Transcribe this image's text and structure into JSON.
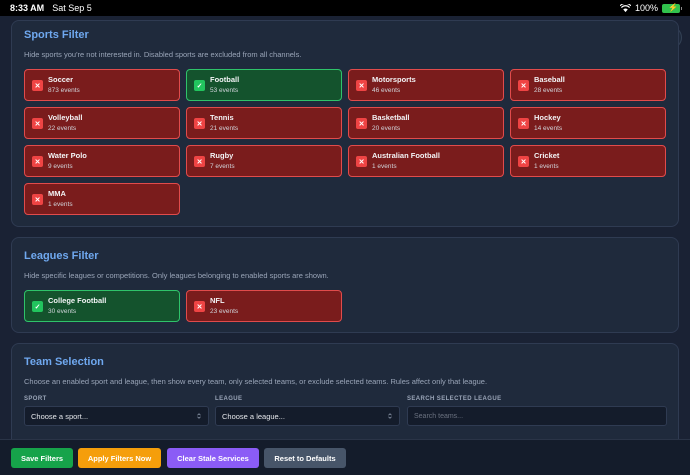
{
  "status_bar": {
    "time": "8:33 AM",
    "date": "Sat Sep 5",
    "battery": "100%"
  },
  "sports_filter": {
    "title": "Sports Filter",
    "description": "Hide sports you're not interested in. Disabled sports are excluded from all channels.",
    "items": [
      {
        "name": "Soccer",
        "count": "873 events",
        "enabled": false
      },
      {
        "name": "Football",
        "count": "53 events",
        "enabled": true
      },
      {
        "name": "Motorsports",
        "count": "46 events",
        "enabled": false
      },
      {
        "name": "Baseball",
        "count": "28 events",
        "enabled": false
      },
      {
        "name": "Volleyball",
        "count": "22 events",
        "enabled": false
      },
      {
        "name": "Tennis",
        "count": "21 events",
        "enabled": false
      },
      {
        "name": "Basketball",
        "count": "20 events",
        "enabled": false
      },
      {
        "name": "Hockey",
        "count": "14 events",
        "enabled": false
      },
      {
        "name": "Water Polo",
        "count": "9 events",
        "enabled": false
      },
      {
        "name": "Rugby",
        "count": "7 events",
        "enabled": false
      },
      {
        "name": "Australian Football",
        "count": "1 events",
        "enabled": false
      },
      {
        "name": "Cricket",
        "count": "1 events",
        "enabled": false
      },
      {
        "name": "MMA",
        "count": "1 events",
        "enabled": false
      }
    ]
  },
  "leagues_filter": {
    "title": "Leagues Filter",
    "description": "Hide specific leagues or competitions. Only leagues belonging to enabled sports are shown.",
    "items": [
      {
        "name": "College Football",
        "count": "30 events",
        "enabled": true
      },
      {
        "name": "NFL",
        "count": "23 events",
        "enabled": false
      }
    ]
  },
  "team_selection": {
    "title": "Team Selection",
    "description": "Choose an enabled sport and league, then show every team, only selected teams, or exclude selected teams. Rules affect only that league.",
    "sport_label": "SPORT",
    "sport_value": "Choose a sport...",
    "league_label": "LEAGUE",
    "league_value": "Choose a league...",
    "search_label": "SEARCH SELECTED LEAGUE",
    "search_placeholder": "Search teams..."
  },
  "actions": {
    "save": "Save Filters",
    "apply": "Apply Filters Now",
    "clear": "Clear Stale Services",
    "reset": "Reset to Defaults"
  },
  "colors": {
    "enabled_border": "#2fc36a",
    "disabled_border": "#e14b4b",
    "save_button": "#16a34a",
    "apply_button": "#f59e0b",
    "clear_button": "#8b5cf6",
    "reset_button": "#475569"
  },
  "icons": {
    "theme_toggle": "moon-icon",
    "wifi": "wifi-icon",
    "battery": "battery-icon"
  }
}
